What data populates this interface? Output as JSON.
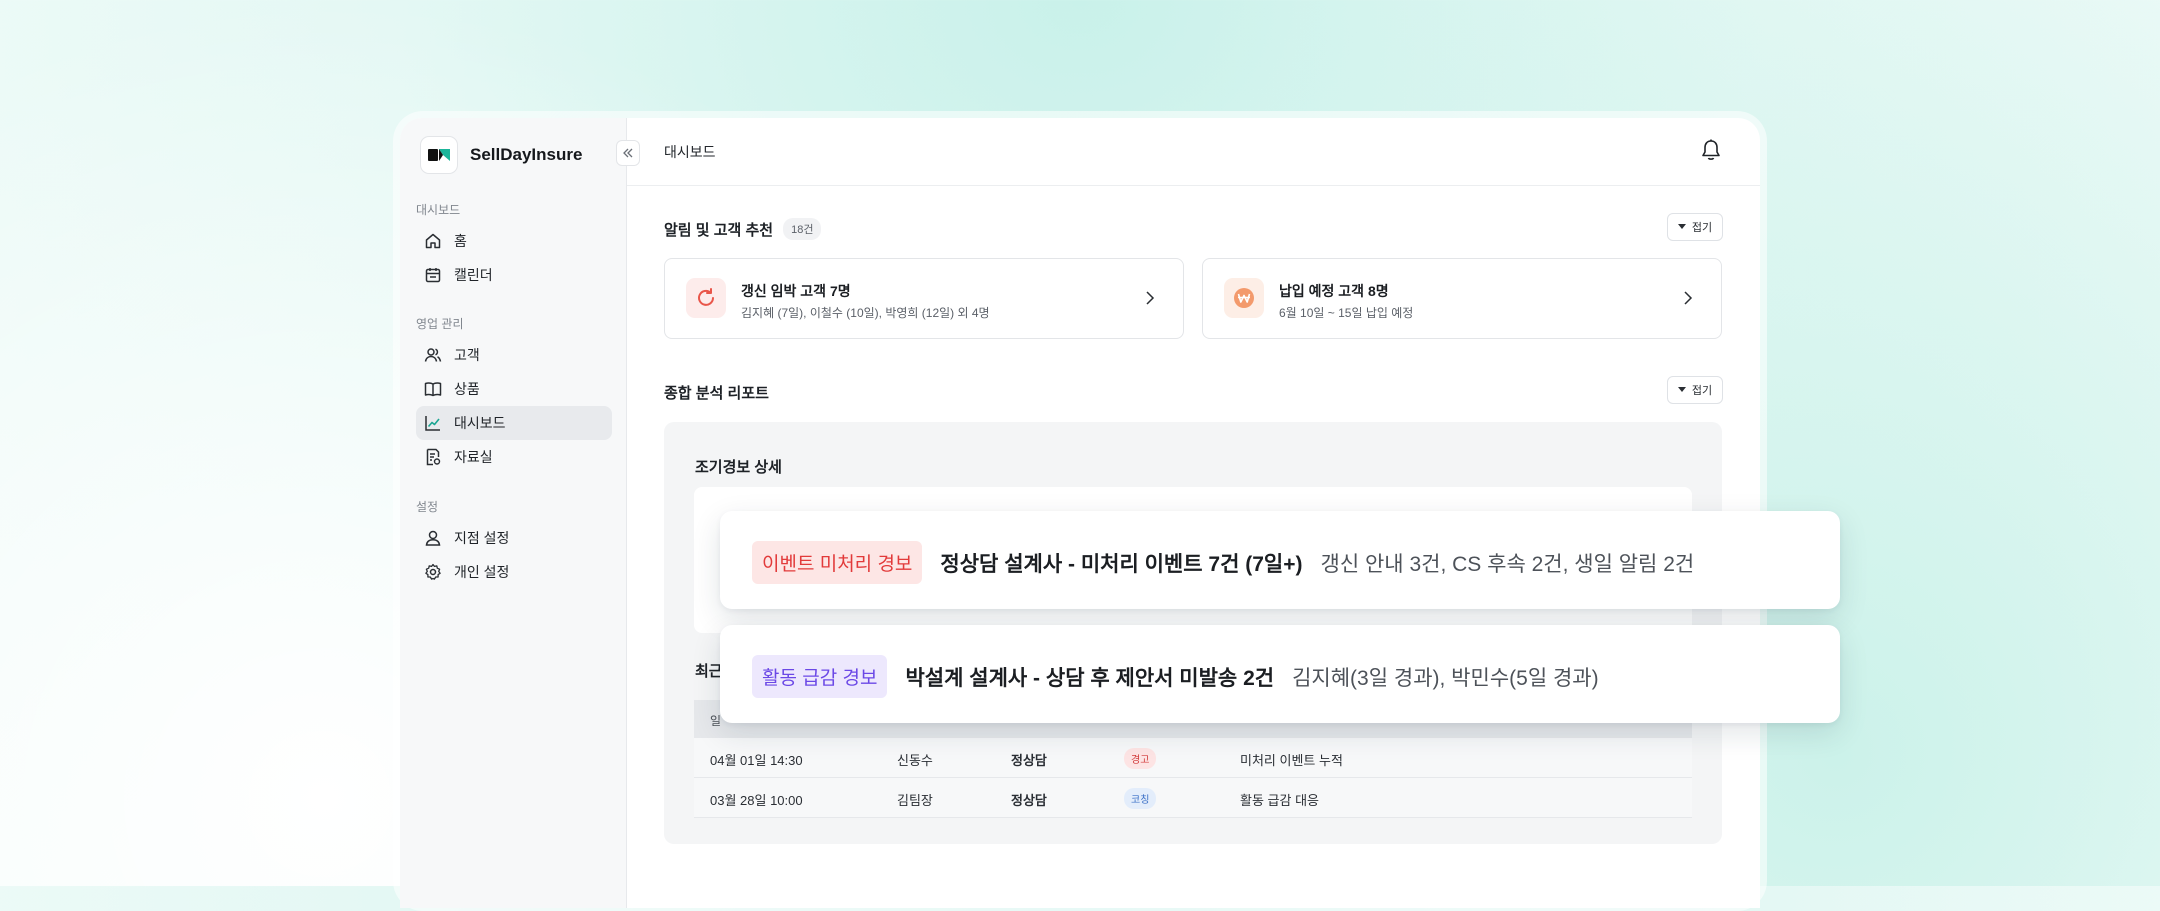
{
  "app": {
    "brand": "SellDayInsure"
  },
  "sidebar": {
    "sections": [
      {
        "label": "대시보드",
        "items": [
          {
            "label": "홈",
            "icon": "home-icon"
          },
          {
            "label": "캘린더",
            "icon": "calendar-icon"
          }
        ]
      },
      {
        "label": "영업 관리",
        "items": [
          {
            "label": "고객",
            "icon": "users-icon"
          },
          {
            "label": "상품",
            "icon": "book-icon"
          },
          {
            "label": "대시보드",
            "icon": "chart-icon",
            "active": true
          },
          {
            "label": "자료실",
            "icon": "document-icon"
          }
        ]
      },
      {
        "label": "설정",
        "items": [
          {
            "label": "지점 설정",
            "icon": "user-icon"
          },
          {
            "label": "개인 설정",
            "icon": "gear-icon"
          }
        ]
      }
    ]
  },
  "header": {
    "title": "대시보드"
  },
  "alerts_section": {
    "title": "알림 및 고객 추천",
    "count": "18건",
    "fold_label": "접기",
    "cards": [
      {
        "title": "갱신 임박 고객 7명",
        "subtitle": "김지혜 (7일), 이철수 (10일), 박영희 (12일) 외 4명",
        "icon": "refresh-icon",
        "accent": "#e9564a"
      },
      {
        "title": "납입 예정 고객 8명",
        "subtitle": "6월 10일 ~ 15일 납입 예정",
        "icon": "won-icon",
        "accent": "#f0845a"
      }
    ]
  },
  "report_section": {
    "title": "종합 분석 리포트",
    "fold_label": "접기",
    "early_warning_title": "조기경보 상세",
    "recent_title": "최근",
    "table_header_first": "일",
    "rows": [
      {
        "datetime": "04월 01일 14:30",
        "manager": "신동수",
        "type": "정상담",
        "tag": "경고",
        "tag_kind": "warn",
        "note": "미처리 이벤트 누적"
      },
      {
        "datetime": "03월 28일 10:00",
        "manager": "김팀장",
        "type": "정상담",
        "tag": "코칭",
        "tag_kind": "coach",
        "note": "활동 급감 대응"
      }
    ]
  },
  "floating_alerts": [
    {
      "tag": "이벤트 미처리 경보",
      "tag_color": "#e23a3a",
      "main": "정상담 설계사 - 미처리 이벤트 7건 (7일+)",
      "detail": "갱신 안내 3건, CS 후속 2건, 생일 알림 2건"
    },
    {
      "tag": "활동 급감 경보",
      "tag_color": "#6b48e6",
      "main": "박설계 설계사 - 상담 후 제안서 미발송 2건",
      "detail": "김지혜(3일 경과), 박민수(5일 경과)"
    }
  ]
}
